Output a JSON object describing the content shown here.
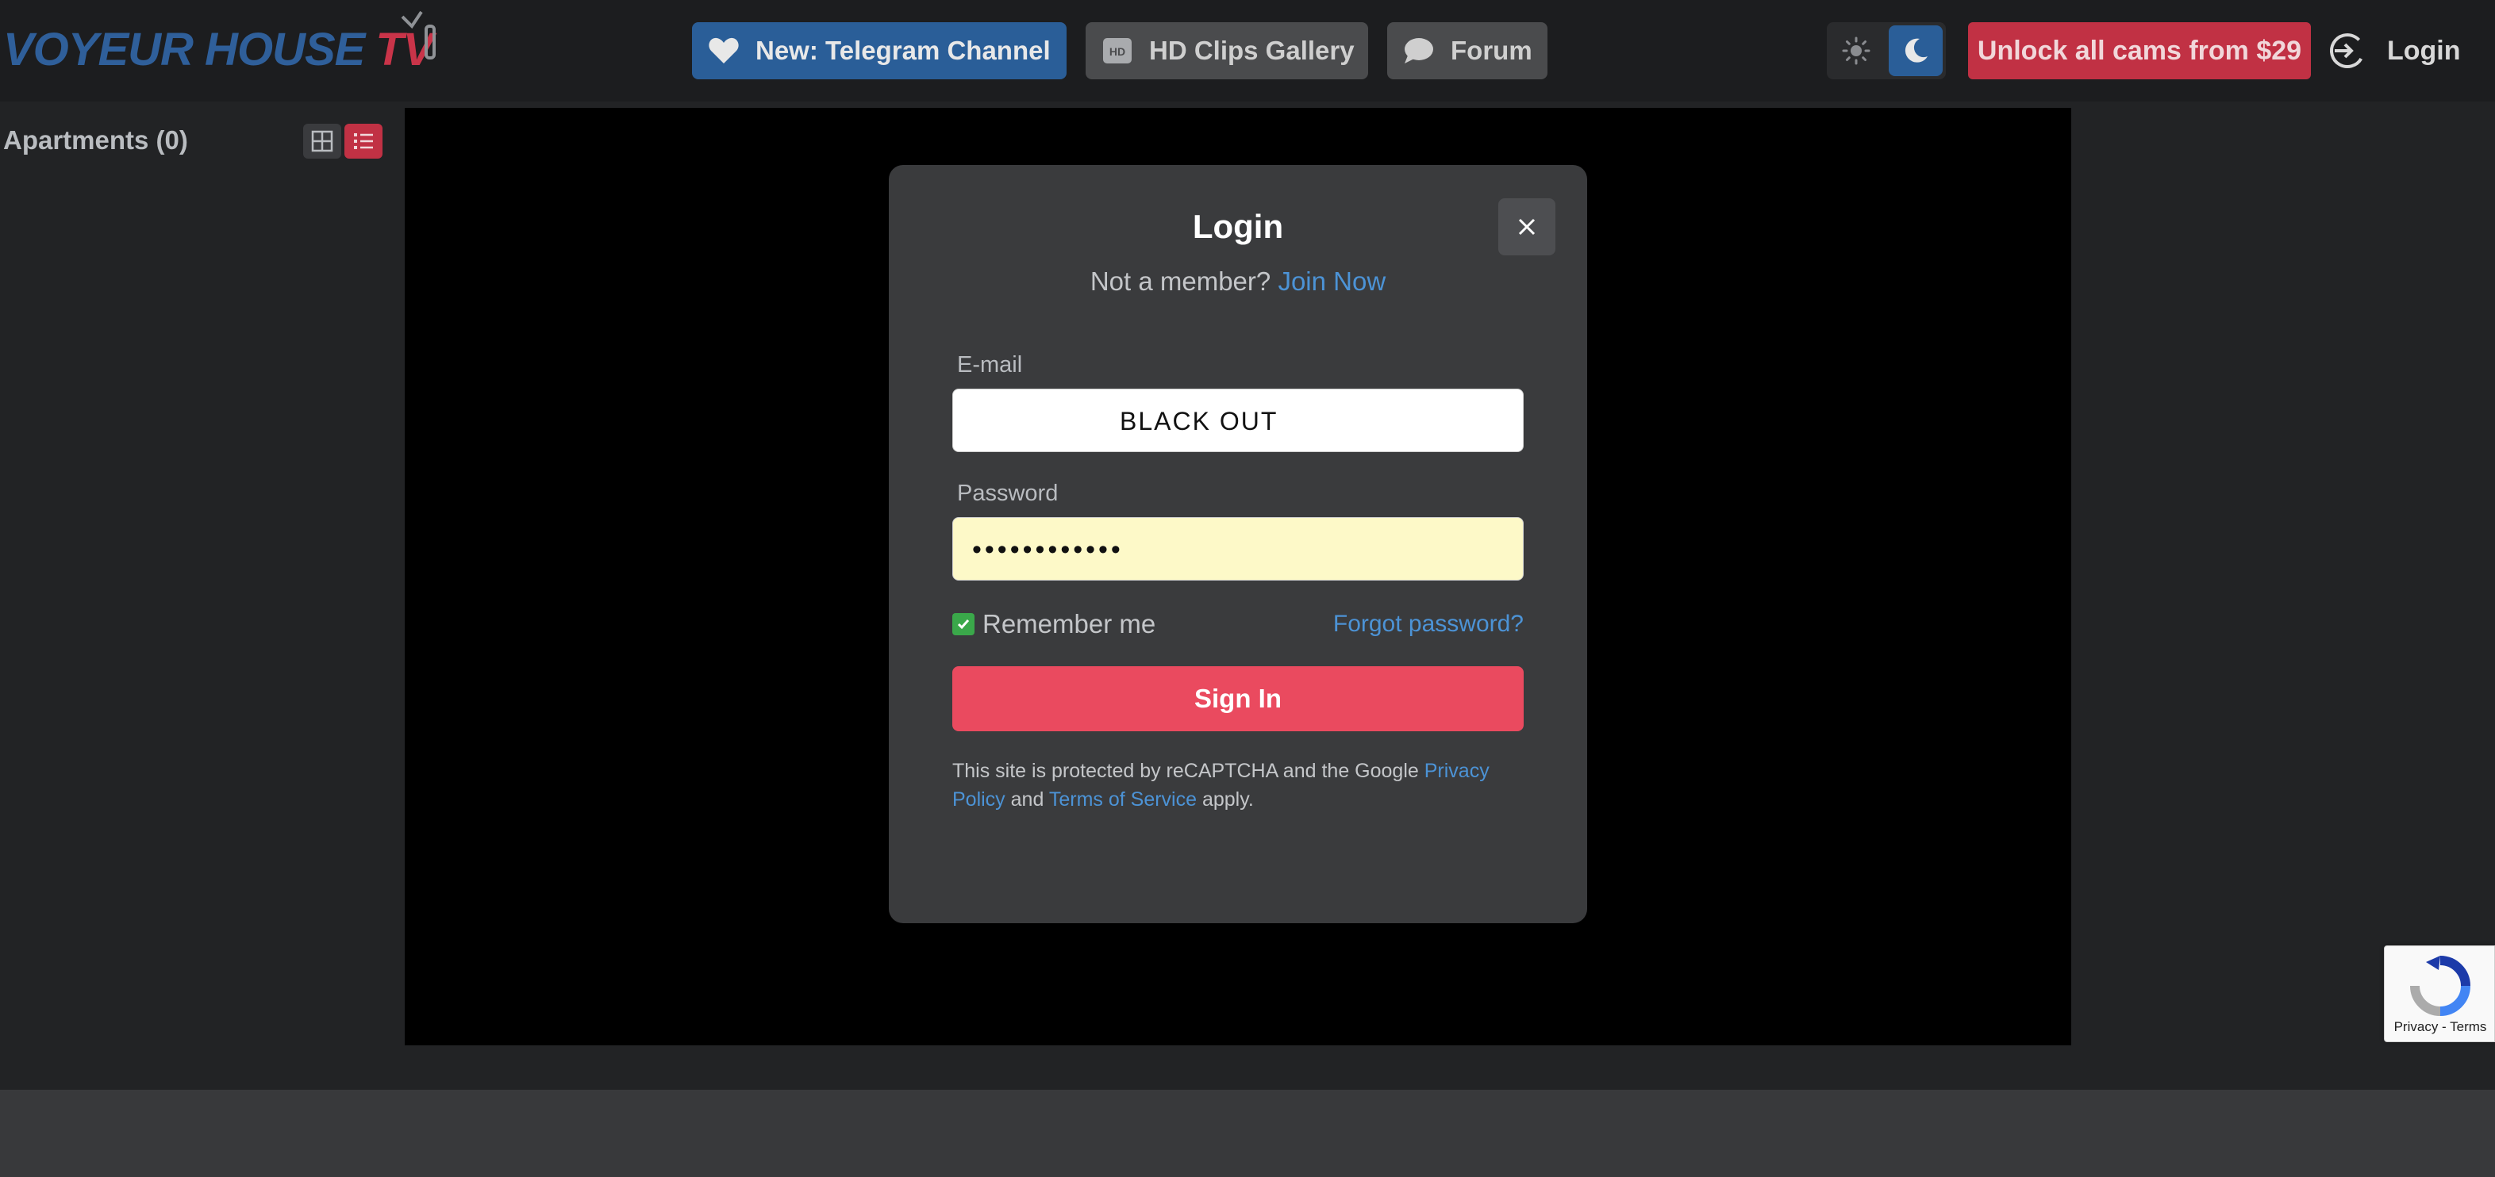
{
  "header": {
    "logo_main": "VOYEUR HOUSE",
    "logo_tv": "TV",
    "nav": {
      "telegram": "New: Telegram Channel",
      "clips": "HD Clips Gallery",
      "forum": "Forum"
    },
    "unlock_label": "Unlock all cams from $29",
    "login_label": "Login",
    "theme": {
      "selected": "dark"
    }
  },
  "sidebar": {
    "title": "Apartments (0)",
    "view_modes": [
      "grid",
      "list"
    ],
    "selected_view": "list"
  },
  "modal": {
    "title": "Login",
    "not_member": "Not a member?",
    "join_now": "Join Now",
    "email_label": "E-mail",
    "email_value": "BLACK   OUT",
    "password_label": "Password",
    "password_value": "••••••••••••",
    "remember_label": "Remember me",
    "remember_checked": true,
    "forgot_label": "Forgot password?",
    "signin_label": "Sign In",
    "recaptcha_text_1": "This site is protected by reCAPTCHA and the Google ",
    "privacy_link": "Privacy Policy",
    "recaptcha_and": " and ",
    "terms_link": "Terms of Service",
    "recaptcha_apply": " apply."
  },
  "recaptcha_badge": {
    "links": "Privacy - Terms"
  },
  "colors": {
    "brand_blue": "#2a5e98",
    "brand_red": "#c13144",
    "signin_red": "#ea4a5f",
    "link_blue": "#4c93d6",
    "background": "#222325"
  },
  "icons": [
    "heart-icon",
    "hd-icon",
    "chat-bubble-icon",
    "sun-icon",
    "moon-icon",
    "login-arrow-icon",
    "grid-view-icon",
    "list-view-icon",
    "close-icon",
    "check-icon",
    "recaptcha-icon"
  ]
}
